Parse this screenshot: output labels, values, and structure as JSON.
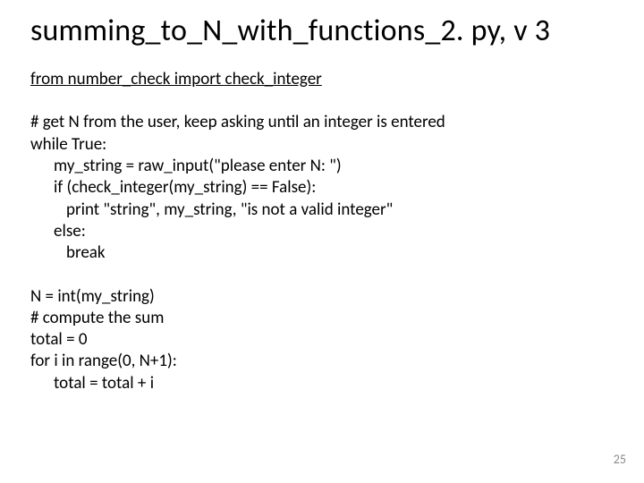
{
  "title": "summing_to_N_with_functions_2. py, v 3",
  "import_line": "from number_check import check_integer",
  "block1": {
    "l0": "# get N from the user, keep asking until an integer is entered",
    "l1": "while True:",
    "l2": "my_string = raw_input(\"please enter N: \")",
    "l3": "if (check_integer(my_string) == False):",
    "l4": "print \"string\", my_string, \"is not a valid integer\"",
    "l5": "else:",
    "l6": "break"
  },
  "block2": {
    "l0": "N = int(my_string)",
    "l1": "# compute the sum",
    "l2": "total = 0",
    "l3": "for i in range(0, N+1):",
    "l4": "total = total + i"
  },
  "page_number": "25"
}
